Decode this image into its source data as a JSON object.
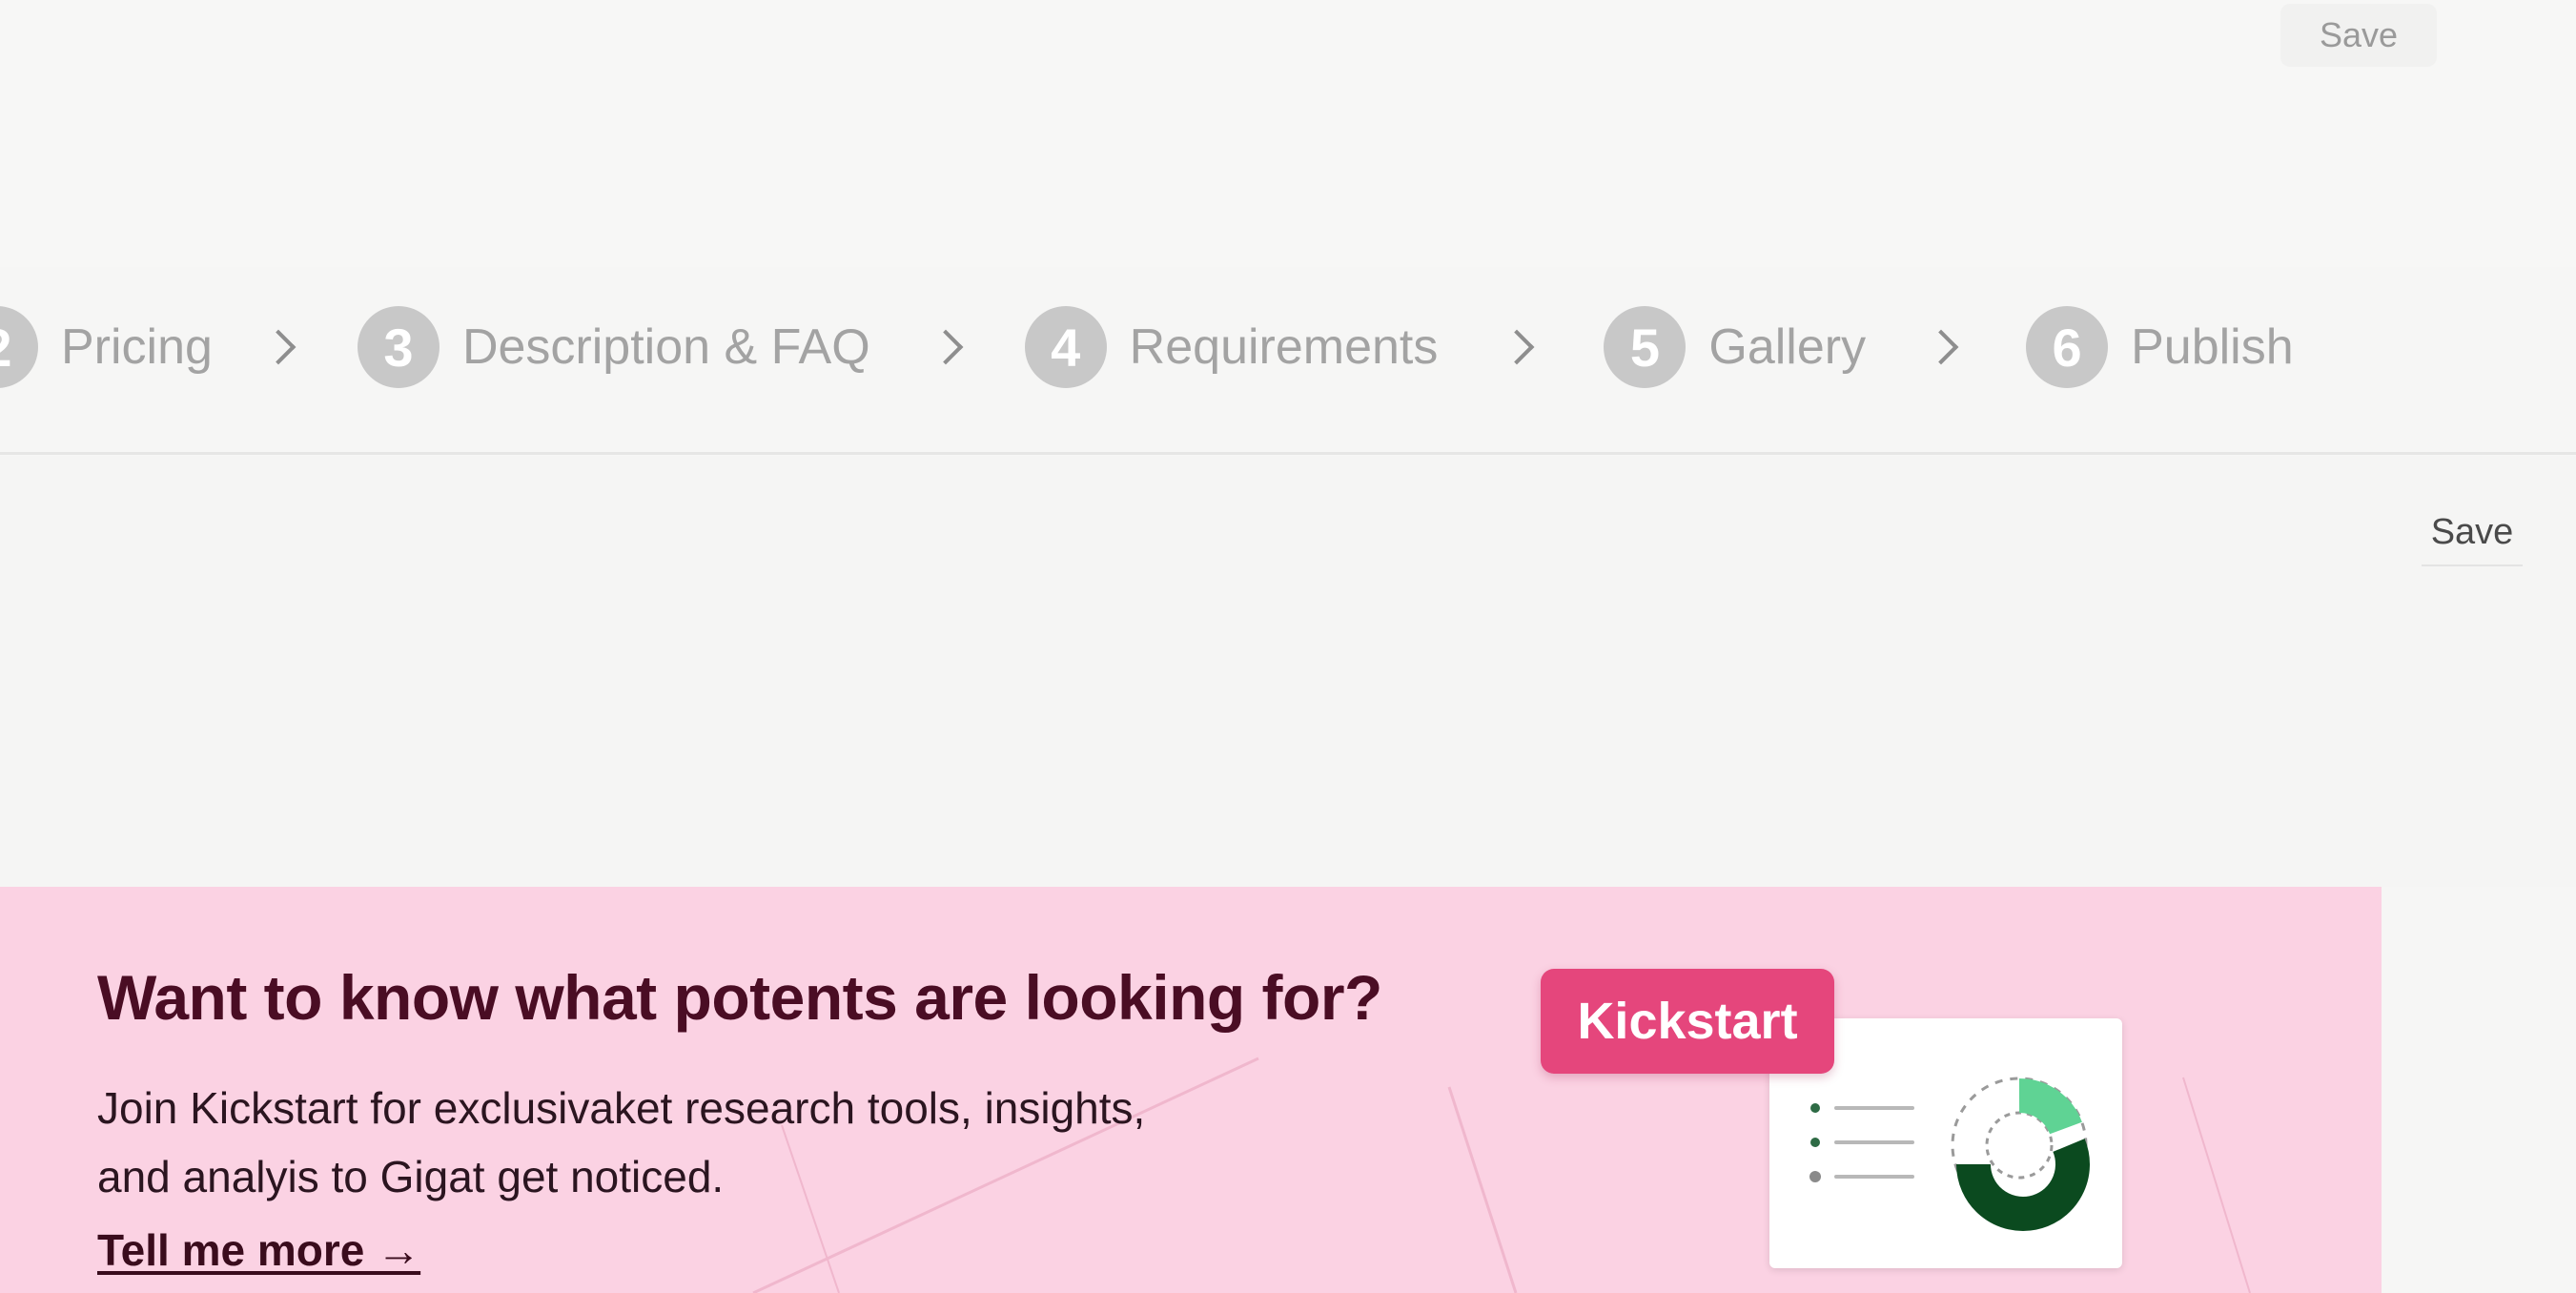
{
  "header": {
    "save_label": "Save"
  },
  "stepper": {
    "steps": [
      {
        "number": "2",
        "label": "Pricing"
      },
      {
        "number": "3",
        "label": "Description & FAQ"
      },
      {
        "number": "4",
        "label": "Requirements"
      },
      {
        "number": "5",
        "label": "Gallery"
      },
      {
        "number": "6",
        "label": "Publish"
      }
    ]
  },
  "content": {
    "save_label": "Save"
  },
  "banner": {
    "title": "Want to know what potents are looking for?",
    "body": "Join Kickstart for exclusivaket research tools, insights, and analyis to Gigat get noticed.",
    "link_label": "Tell me more →",
    "badge_label": "Kickstart",
    "colors": {
      "background": "#fbd2e3",
      "badge": "#e5467c",
      "donut_dark": "#0b4a1f",
      "donut_light": "#5fd394"
    },
    "illustration_icons": [
      "list-icon",
      "donut-chart-icon"
    ]
  }
}
